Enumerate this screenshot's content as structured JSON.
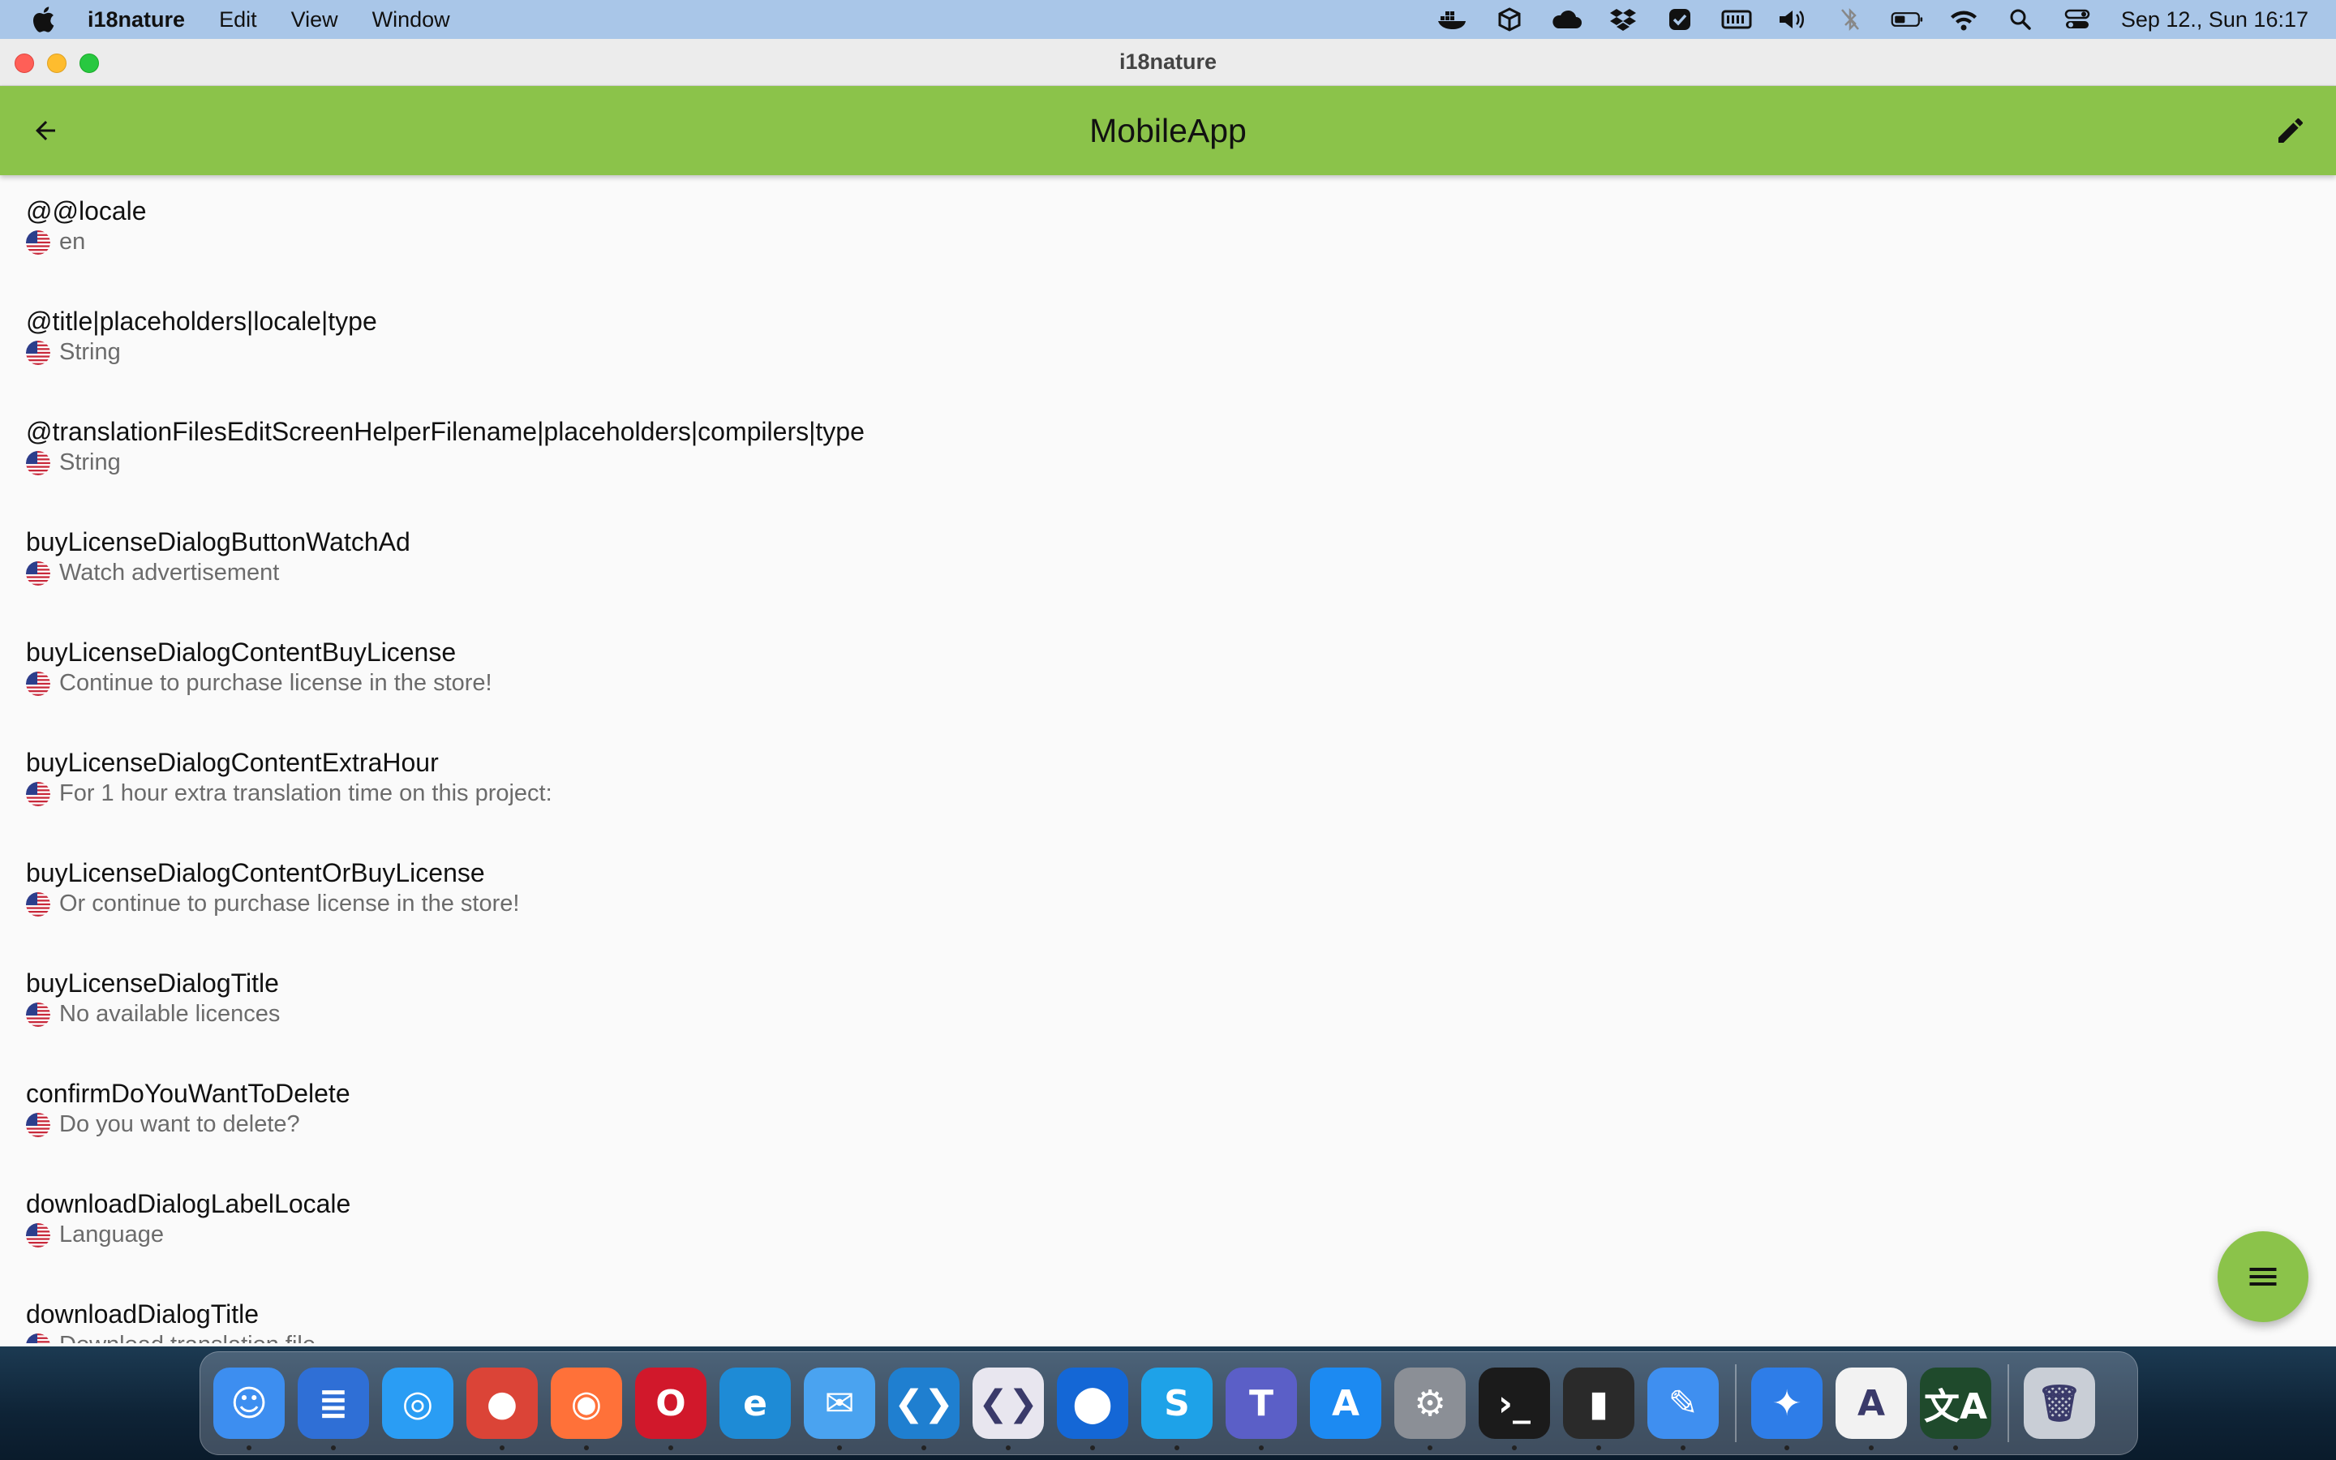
{
  "menubar": {
    "app_name": "i18nature",
    "menus": [
      "Edit",
      "View",
      "Window"
    ],
    "clock": "Sep 12., Sun  16:17",
    "tray_icons": [
      "docker-icon",
      "box-icon",
      "cloud-icon",
      "dropbox-icon",
      "checkmark-app-icon",
      "memory-meter-icon",
      "volume-icon",
      "bluetooth-off-icon",
      "battery-icon",
      "wifi-icon",
      "search-icon",
      "control-center-icon"
    ]
  },
  "window": {
    "title": "i18nature"
  },
  "appbar": {
    "title": "MobileApp",
    "back_icon": "arrow-back-icon",
    "edit_icon": "pencil-icon",
    "color": "#8bc34a"
  },
  "entries": [
    {
      "key": "@@locale",
      "value": "en"
    },
    {
      "key": "@title|placeholders|locale|type",
      "value": "String"
    },
    {
      "key": "@translationFilesEditScreenHelperFilename|placeholders|compilers|type",
      "value": "String"
    },
    {
      "key": "buyLicenseDialogButtonWatchAd",
      "value": "Watch advertisement"
    },
    {
      "key": "buyLicenseDialogContentBuyLicense",
      "value": "Continue to purchase license in the store!"
    },
    {
      "key": "buyLicenseDialogContentExtraHour",
      "value": "For 1 hour extra translation time on this project:"
    },
    {
      "key": "buyLicenseDialogContentOrBuyLicense",
      "value": "Or continue to purchase license in the store!"
    },
    {
      "key": "buyLicenseDialogTitle",
      "value": "No available licences"
    },
    {
      "key": "confirmDoYouWantToDelete",
      "value": "Do you want to delete?"
    },
    {
      "key": "downloadDialogLabelLocale",
      "value": "Language"
    },
    {
      "key": "downloadDialogTitle",
      "value": "Download translation file"
    }
  ],
  "fab": {
    "icon": "menu-icon"
  },
  "dock": {
    "apps": [
      {
        "name": "finder",
        "glyph": "☺",
        "color": "#3d8ef0",
        "running": true
      },
      {
        "name": "file-manager",
        "glyph": "≣",
        "color": "#2f6fd6",
        "running": true
      },
      {
        "name": "safari",
        "glyph": "◎",
        "color": "#2a9df4",
        "running": false
      },
      {
        "name": "chrome",
        "glyph": "●",
        "color": "#db4437",
        "running": true
      },
      {
        "name": "firefox",
        "glyph": "◉",
        "color": "#ff7139",
        "running": true
      },
      {
        "name": "opera",
        "glyph": "O",
        "color": "#d1182b",
        "running": true
      },
      {
        "name": "edge",
        "glyph": "e",
        "color": "#1e8bd6",
        "running": false
      },
      {
        "name": "mail",
        "glyph": "✉",
        "color": "#4aa3f0",
        "running": true
      },
      {
        "name": "vscode",
        "glyph": "❮❯",
        "color": "#1f7fd0",
        "running": true
      },
      {
        "name": "code-editor",
        "glyph": "❮❯",
        "color": "#e8e6ef",
        "running": true
      },
      {
        "name": "sourcetree",
        "glyph": "⬤",
        "color": "#1467d6",
        "running": true
      },
      {
        "name": "skype",
        "glyph": "S",
        "color": "#1ea2e8",
        "running": true
      },
      {
        "name": "teams",
        "glyph": "T",
        "color": "#5b5fc7",
        "running": true
      },
      {
        "name": "app-store",
        "glyph": "A",
        "color": "#1c8af2",
        "running": false
      },
      {
        "name": "system-preferences",
        "glyph": "⚙",
        "color": "#8b8f96",
        "running": true
      },
      {
        "name": "terminal",
        "glyph": "›_",
        "color": "#1b1b1b",
        "running": true
      },
      {
        "name": "memory-monitor",
        "glyph": "▮",
        "color": "#2a2a2a",
        "running": true
      },
      {
        "name": "simulator",
        "glyph": "✎",
        "color": "#3f8ff0",
        "running": true
      }
    ],
    "apps_after_separator": [
      {
        "name": "xcode",
        "glyph": "✦",
        "color": "#2e7de8",
        "running": true
      },
      {
        "name": "android-studio",
        "glyph": "A",
        "color": "#f2f2f2",
        "running": true
      },
      {
        "name": "i18nature",
        "glyph": "文A",
        "color": "#1f4a2c",
        "running": true
      }
    ],
    "trash": {
      "name": "trash",
      "glyph": "🗑",
      "color": "#c9ced6"
    }
  }
}
